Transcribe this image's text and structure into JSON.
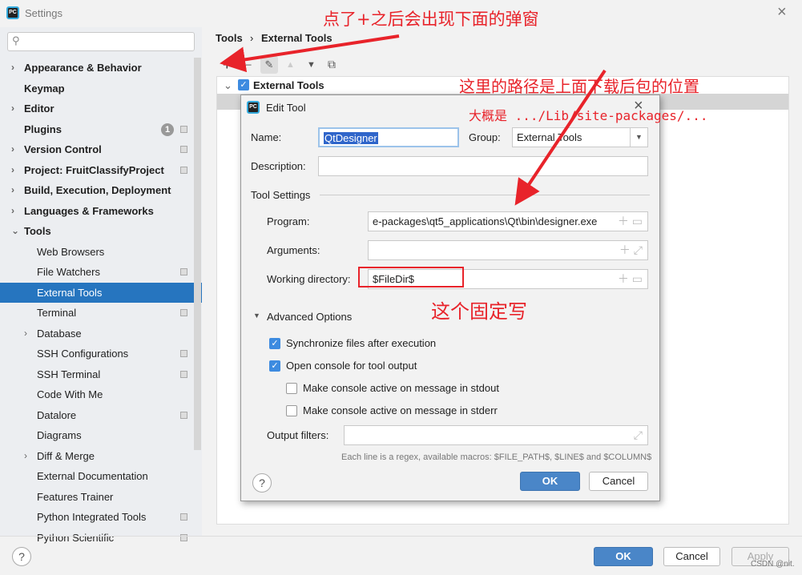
{
  "window": {
    "title": "Settings",
    "close_icon": "×"
  },
  "sidebar": {
    "search_placeholder": "",
    "items": [
      {
        "label": "Appearance & Behavior",
        "bold": true,
        "expand": true
      },
      {
        "label": "Keymap",
        "bold": true
      },
      {
        "label": "Editor",
        "bold": true,
        "expand": true
      },
      {
        "label": "Plugins",
        "bold": true,
        "badge": "1",
        "sq": true
      },
      {
        "label": "Version Control",
        "bold": true,
        "expand": true,
        "sq": true
      },
      {
        "label": "Project: FruitClassifyProject",
        "bold": true,
        "expand": true,
        "sq": true
      },
      {
        "label": "Build, Execution, Deployment",
        "bold": true,
        "expand": true
      },
      {
        "label": "Languages & Frameworks",
        "bold": true,
        "expand": true
      },
      {
        "label": "Tools",
        "bold": true,
        "expanded": true
      },
      {
        "label": "Web Browsers"
      },
      {
        "label": "File Watchers",
        "sq": true
      },
      {
        "label": "External Tools",
        "selected": true
      },
      {
        "label": "Terminal",
        "sq": true
      },
      {
        "label": "Database",
        "expand": true
      },
      {
        "label": "SSH Configurations",
        "sq": true
      },
      {
        "label": "SSH Terminal",
        "sq": true
      },
      {
        "label": "Code With Me"
      },
      {
        "label": "Datalore",
        "sq": true
      },
      {
        "label": "Diagrams"
      },
      {
        "label": "Diff & Merge",
        "expand": true
      },
      {
        "label": "External Documentation"
      },
      {
        "label": "Features Trainer"
      },
      {
        "label": "Python Integrated Tools",
        "sq": true
      },
      {
        "label": "Python Scientific",
        "sq": true
      }
    ]
  },
  "breadcrumb": {
    "parent": "Tools",
    "sep": "›",
    "current": "External Tools"
  },
  "toolbar": {
    "add": "+",
    "remove": "−",
    "edit": "✎",
    "up": "▲",
    "down": "▼",
    "copy": "⧉"
  },
  "tree": {
    "root": "External Tools"
  },
  "dialog": {
    "title": "Edit Tool",
    "name_label": "Name:",
    "name_value": "QtDesigner",
    "group_label": "Group:",
    "group_value": "External Tools",
    "description_label": "Description:",
    "description_value": "",
    "tool_settings": "Tool Settings",
    "program_label": "Program:",
    "program_value": "e-packages\\qt5_applications\\Qt\\bin\\designer.exe",
    "arguments_label": "Arguments:",
    "arguments_value": "",
    "workdir_label": "Working directory:",
    "workdir_value": "$FileDir$",
    "advanced": "Advanced Options",
    "options": [
      {
        "label": "Synchronize files after execution",
        "checked": true
      },
      {
        "label": "Open console for tool output",
        "checked": true
      },
      {
        "label": "Make console active on message in stdout",
        "checked": false
      },
      {
        "label": "Make console active on message in stderr",
        "checked": false
      }
    ],
    "output_filters_label": "Output filters:",
    "output_filters_value": "",
    "hint": "Each line is a regex, available macros: $FILE_PATH$, $LINE$ and $COLUMN$",
    "ok": "OK",
    "cancel": "Cancel",
    "help": "?"
  },
  "footer": {
    "ok": "OK",
    "cancel": "Cancel",
    "apply": "Apply",
    "help": "?",
    "watermark": "CSDN @nit."
  },
  "annotations": {
    "top": "点了+之后会出现下面的弹窗",
    "path": "这里的路径是上面下载后包的位置",
    "path_hint": "大概是 .../Lib/site-packages/...",
    "fixed": "这个固定写",
    "color": "#e8232a"
  }
}
